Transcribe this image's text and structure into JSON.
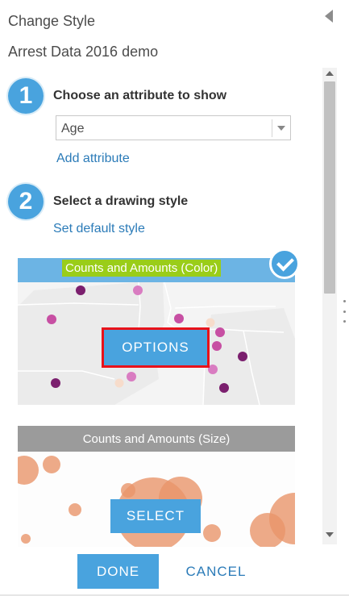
{
  "panel": {
    "title": "Change Style",
    "layer_name": "Arrest Data 2016 demo",
    "collapse_icon": "triangle-left-icon"
  },
  "step1": {
    "number": "1",
    "label": "Choose an attribute to show",
    "attribute_value": "Age",
    "add_attribute_link": "Add attribute"
  },
  "step2": {
    "number": "2",
    "label": "Select a drawing style",
    "default_style_link": "Set default style"
  },
  "styles": [
    {
      "title": "Counts and Amounts (Color)",
      "selected": true,
      "button_label": "OPTIONS",
      "point_colors": [
        "#7b1f6e",
        "#c74fa3",
        "#d97cc1",
        "#f7dccb"
      ]
    },
    {
      "title": "Counts and Amounts (Size)",
      "selected": false,
      "button_label": "SELECT",
      "circle_color": "#e8956a"
    }
  ],
  "footer": {
    "done_label": "DONE",
    "cancel_label": "CANCEL"
  },
  "colors": {
    "accent": "#49a3de",
    "link": "#2b7bb8",
    "highlight_outline": "#e8121a",
    "label_highlight": "#9acd19"
  }
}
